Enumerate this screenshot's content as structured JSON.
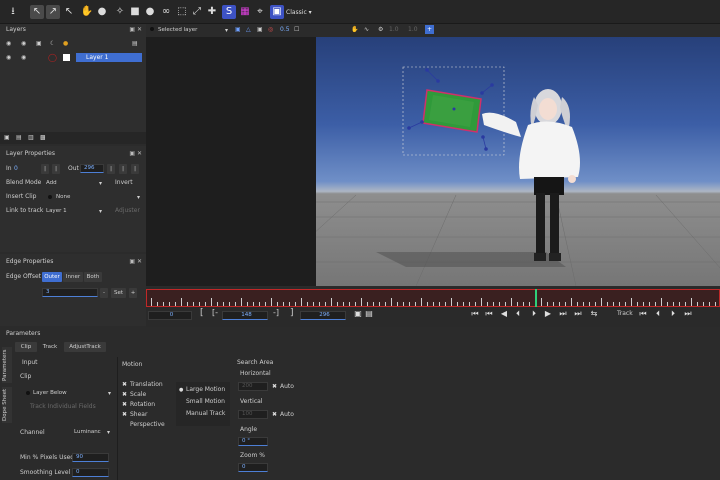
{
  "toolbar": {
    "icons": [
      "import-icon",
      "select-arrow-icon",
      "pick-icon",
      "bone-icon",
      "hand-icon",
      "pin-icon",
      "magic-wand-icon",
      "rect-select-icon",
      "circle-icon",
      "link-icon",
      "freeform-select-icon",
      "transform-icon",
      "move-icon",
      "s-icon",
      "grid-icon",
      "fit-icon",
      "frame-icon"
    ],
    "s_label": "S",
    "workspace": "Classic"
  },
  "viewport_bar": {
    "layer_select": "Selected layer",
    "ratio": "0.5",
    "field1": "1.0",
    "field2": "1.0"
  },
  "layers": {
    "title": "Layers",
    "layer1_name": "Layer 1"
  },
  "layer_props": {
    "title": "Layer Properties",
    "in_label": "In",
    "in_value": "0",
    "out_label": "Out",
    "out_value": "296",
    "blend_label": "Blend Mode",
    "blend_value": "Add",
    "invert_label": "Invert",
    "insert_label": "Insert Clip",
    "insert_value": "None",
    "link_label": "Link to track",
    "link_value": "Layer 1",
    "adjust_label": "Adjuster"
  },
  "edge_props": {
    "title": "Edge Properties",
    "offset_label": "Edge Offset",
    "tabs": [
      "Outer",
      "Inner",
      "Both"
    ],
    "value": "3",
    "minus": "-",
    "set": "Set",
    "plus": "+"
  },
  "timeline": {
    "start": "0",
    "current": "148",
    "end": "296",
    "track_label": "Track",
    "bracket_left": "[",
    "bracket_mid_l": "[-",
    "bracket_mid_r": "-]",
    "bracket_right": "]",
    "playhead_fraction": 0.678
  },
  "params": {
    "title": "Parameters",
    "tabs": [
      "Clip",
      "Track",
      "AdjustTrack"
    ],
    "side_tabs": [
      "Parameters",
      "Dope Sheet"
    ],
    "input_label": "Input",
    "clip_label": "Clip",
    "clip_value": "Layer Below",
    "track_fields": "Track Individual Fields",
    "channel_label": "Channel",
    "channel_value": "Luminanc",
    "min_pixels_label": "Min % Pixels Used",
    "min_pixels_value": "90",
    "smoothing_label": "Smoothing Level",
    "smoothing_value": "0",
    "motion_label": "Motion",
    "motion_items": [
      "Translation",
      "Scale",
      "Rotation",
      "Shear",
      "Perspective"
    ],
    "motion_size": [
      "Large Motion",
      "Small Motion",
      "Manual Track"
    ],
    "search_label": "Search Area",
    "horizontal_label": "Horizontal",
    "horizontal_value": "200",
    "vertical_label": "Vertical",
    "vertical_value": "100",
    "auto_label": "Auto",
    "angle_label": "Angle",
    "angle_value": "0 °",
    "zoom_label": "Zoom %",
    "zoom_value": "0"
  }
}
